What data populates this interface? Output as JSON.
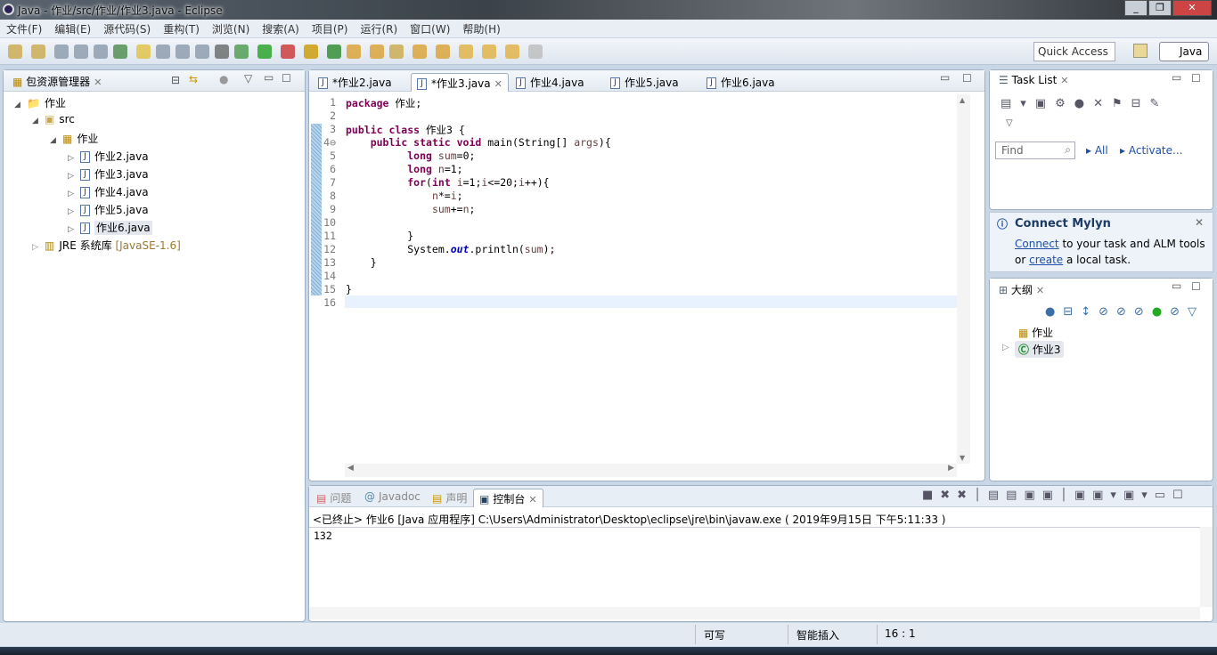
{
  "window": {
    "title": "Java  -  作业/src/作业/作业3.java  -  Eclipse",
    "controls": [
      "_",
      "❐",
      "✕"
    ]
  },
  "menu": [
    "文件(F)",
    "编辑(E)",
    "源代码(S)",
    "重构(T)",
    "浏览(N)",
    "搜索(A)",
    "项目(P)",
    "运行(R)",
    "窗口(W)",
    "帮助(H)"
  ],
  "toolbar": {
    "quick_access": "Quick Access",
    "perspective": "Java"
  },
  "package_explorer": {
    "title": "包资源管理器",
    "tree": [
      {
        "label": "作业",
        "level": 0,
        "icon": "project-icon",
        "expanded": true
      },
      {
        "label": "src",
        "level": 1,
        "icon": "source-folder-icon",
        "expanded": true
      },
      {
        "label": "作业",
        "level": 2,
        "icon": "package-icon",
        "expanded": true
      },
      {
        "label": "作业2.java",
        "level": 3,
        "icon": "java-file-icon"
      },
      {
        "label": "作业3.java",
        "level": 3,
        "icon": "java-file-icon"
      },
      {
        "label": "作业4.java",
        "level": 3,
        "icon": "java-file-icon"
      },
      {
        "label": "作业5.java",
        "level": 3,
        "icon": "java-file-icon"
      },
      {
        "label": "作业6.java",
        "level": 3,
        "icon": "java-file-icon",
        "selected": true
      }
    ],
    "jre": {
      "label": "JRE 系统库",
      "version": "[JavaSE-1.6]"
    }
  },
  "editor": {
    "tabs": [
      {
        "label": "*作业2.java"
      },
      {
        "label": "*作业3.java",
        "active": true
      },
      {
        "label": "作业4.java"
      },
      {
        "label": "作业5.java"
      },
      {
        "label": "作业6.java"
      }
    ],
    "lines": [
      [
        [
          "kw",
          "package"
        ],
        [
          "p",
          " 作业;"
        ]
      ],
      [],
      [
        [
          "kw",
          "public class"
        ],
        [
          "p",
          " 作业3 {"
        ]
      ],
      [
        [
          "p",
          "    "
        ],
        [
          "kw",
          "public static void"
        ],
        [
          "p",
          " main(String[] "
        ],
        [
          "var",
          "args"
        ],
        [
          "p",
          "){"
        ]
      ],
      [
        [
          "p",
          "          "
        ],
        [
          "kw",
          "long"
        ],
        [
          "p",
          " "
        ],
        [
          "var",
          "sum"
        ],
        [
          "p",
          "=0;"
        ]
      ],
      [
        [
          "p",
          "          "
        ],
        [
          "kw",
          "long"
        ],
        [
          "p",
          " "
        ],
        [
          "var",
          "n"
        ],
        [
          "p",
          "=1;"
        ]
      ],
      [
        [
          "p",
          "          "
        ],
        [
          "kw",
          "for"
        ],
        [
          "p",
          "("
        ],
        [
          "kw",
          "int"
        ],
        [
          "p",
          " "
        ],
        [
          "var",
          "i"
        ],
        [
          "p",
          "=1;"
        ],
        [
          "var",
          "i"
        ],
        [
          "p",
          "<=20;"
        ],
        [
          "var",
          "i"
        ],
        [
          "p",
          "++){"
        ]
      ],
      [
        [
          "p",
          "              "
        ],
        [
          "var",
          "n"
        ],
        [
          "p",
          "*="
        ],
        [
          "var",
          "i"
        ],
        [
          "p",
          ";"
        ]
      ],
      [
        [
          "p",
          "              "
        ],
        [
          "var",
          "sum"
        ],
        [
          "p",
          "+="
        ],
        [
          "var",
          "n"
        ],
        [
          "p",
          ";"
        ]
      ],
      [],
      [
        [
          "p",
          "          }"
        ]
      ],
      [
        [
          "p",
          "          System."
        ],
        [
          "fld",
          "out"
        ],
        [
          "p",
          ".println("
        ],
        [
          "var",
          "sum"
        ],
        [
          "p",
          ");"
        ]
      ],
      [
        [
          "p",
          "    }"
        ]
      ],
      [],
      [
        [
          "p",
          "}"
        ]
      ],
      []
    ]
  },
  "task_list": {
    "title": "Task List",
    "find_placeholder": "Find",
    "all": "All",
    "activate": "Activate..."
  },
  "mylyn": {
    "title": "Connect Mylyn",
    "connect": "Connect",
    "text1": " to your task and ALM tools",
    "or": "or ",
    "create": "create",
    "text2": " a local task."
  },
  "outline": {
    "title": "大纲",
    "items": [
      {
        "label": "作业",
        "icon": "package-icon"
      },
      {
        "label": "作业3",
        "icon": "class-icon"
      }
    ]
  },
  "console": {
    "tabs": [
      {
        "label": "问题"
      },
      {
        "label": "Javadoc"
      },
      {
        "label": "声明"
      },
      {
        "label": "控制台",
        "active": true
      }
    ],
    "header": "<已终止> 作业6 [Java 应用程序] C:\\Users\\Administrator\\Desktop\\eclipse\\jre\\bin\\javaw.exe ( 2019年9月15日 下午5:11:33 )",
    "output": "132"
  },
  "status": {
    "writable": "可写",
    "insert_mode": "智能插入",
    "position": "16 : 1"
  },
  "colors": {
    "keyword": "#7f0055",
    "variable": "#6a3e3e",
    "field": "#0000c0",
    "link": "#1f4fa8",
    "current_line": "#e8f2fe"
  }
}
